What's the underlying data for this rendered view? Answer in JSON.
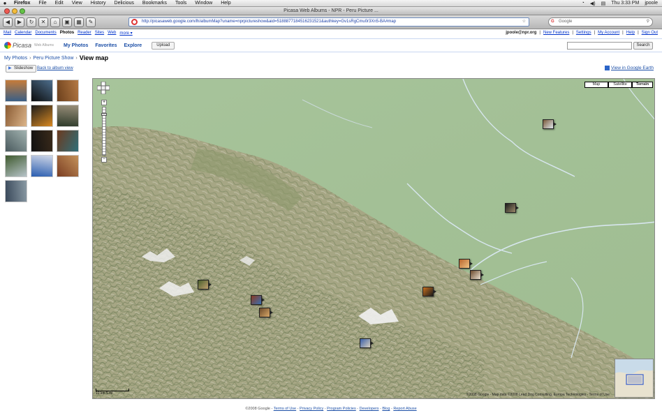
{
  "menubar": {
    "app": "Firefox",
    "items": [
      "File",
      "Edit",
      "View",
      "History",
      "Delicious",
      "Bookmarks",
      "Tools",
      "Window",
      "Help"
    ],
    "clock": "Thu 3:33 PM",
    "user": "jpoole"
  },
  "window": {
    "title": "Picasa Web Albums - NPR - Peru Picture ..."
  },
  "browser": {
    "url": "http://picasaweb.google.com/lh/albumMap?uname=nprpictureshow&aid=5188877184516231521&authkey=Gv1sRgCmu0r3Xn5-BA#map",
    "search_placeholder": "Google"
  },
  "gbar": {
    "links": [
      "Mail",
      "Calendar",
      "Documents",
      "Photos",
      "Reader",
      "Sites",
      "Web",
      "more ▾"
    ],
    "current": "Photos",
    "email": "jpoole@npr.org",
    "user_links": [
      "New Features",
      "Settings",
      "My Account",
      "Help",
      "Sign Out"
    ]
  },
  "picasa": {
    "logo_text": "Picasa",
    "logo_sub": "Web Albums",
    "tabs": [
      "My Photos",
      "Favorites",
      "Explore"
    ],
    "upload_label": "Upload",
    "search_button": "Search"
  },
  "breadcrumb": {
    "root": "My Photos",
    "album": "Peru Picture Show",
    "current": "View map"
  },
  "actions": {
    "slideshow": "Slideshow",
    "back": "Back to album view",
    "earth": "View in Google Earth"
  },
  "thumbnails": [
    {
      "colors": [
        "#3a5f86",
        "#c67c3a"
      ]
    },
    {
      "colors": [
        "#0b0b0b",
        "#4e6f8e"
      ]
    },
    {
      "colors": [
        "#6b3f1c",
        "#b57a44"
      ]
    },
    {
      "colors": [
        "#8a5b33",
        "#dcb58a"
      ]
    },
    {
      "colors": [
        "#1b1b1b",
        "#d98a22"
      ]
    },
    {
      "colors": [
        "#2d3a2a",
        "#9a8f7a"
      ]
    },
    {
      "colors": [
        "#4a5a5e",
        "#a2b3b0"
      ]
    },
    {
      "colors": [
        "#111111",
        "#3a2a1a"
      ]
    },
    {
      "colors": [
        "#6b3a1f",
        "#2f6f7a"
      ]
    },
    {
      "colors": [
        "#3f5a2e",
        "#b7c4c9"
      ]
    },
    {
      "colors": [
        "#2a5db0",
        "#cfd6e6"
      ]
    },
    {
      "colors": [
        "#7a3d22",
        "#c4925a"
      ]
    },
    {
      "colors": [
        "#39485a",
        "#8a9aa4"
      ]
    }
  ],
  "map": {
    "types": [
      "Map",
      "Satellite",
      "Terrain"
    ],
    "selected_type": "Terrain",
    "scale_labels": [
      "10 km",
      "5 mi"
    ],
    "copyright": "©2008 Google - Map data ©2008 Lead Dog Consulting, Europa Technologies - Terms of Use",
    "markers": [
      {
        "colors": [
          "#7b5a3a",
          "#dfe6ec"
        ]
      },
      {
        "colors": [
          "#1b1b1b",
          "#9b8a6a"
        ]
      },
      {
        "colors": [
          "#b8652d",
          "#f1c585"
        ]
      },
      {
        "colors": [
          "#6a4a2c",
          "#eae0d0"
        ]
      },
      {
        "colors": [
          "#c76f1f",
          "#1a1a1a"
        ]
      },
      {
        "colors": [
          "#4a5f2c",
          "#c0a070"
        ]
      },
      {
        "colors": [
          "#8a3a22",
          "#3a6fb0"
        ]
      },
      {
        "colors": [
          "#6b4a2a",
          "#d8a868"
        ]
      },
      {
        "colors": [
          "#3a5fa8",
          "#d8d0c0"
        ]
      }
    ]
  },
  "footer": {
    "copyright": "©2008 Google",
    "links": [
      "Terms of Use",
      "Privacy Policy",
      "Program Policies",
      "Developers",
      "Blog",
      "Report Abuse"
    ]
  }
}
